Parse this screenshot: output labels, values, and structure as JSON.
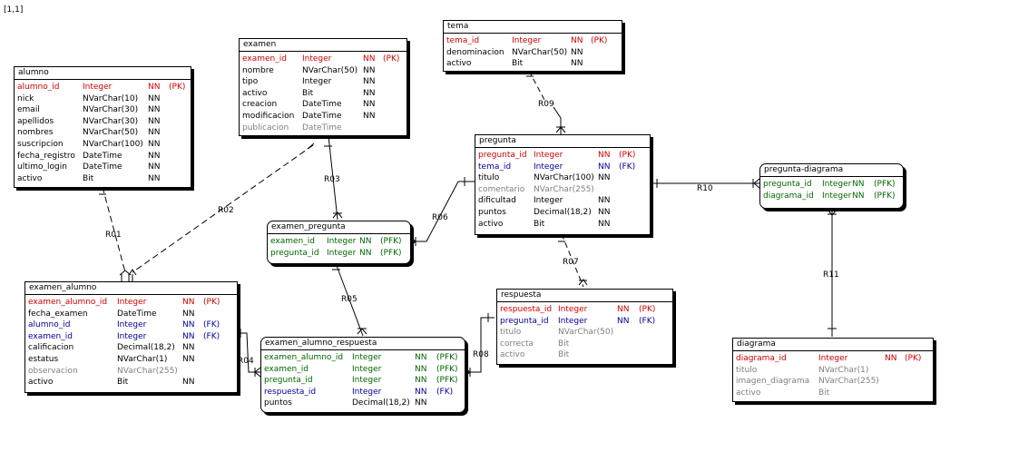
{
  "coord_label": "[1,1]",
  "entities": {
    "alumno": {
      "name": "alumno",
      "columns": [
        {
          "name": "alumno_id",
          "type": "Integer",
          "nn": "NN",
          "key": "(PK)",
          "role": "pk"
        },
        {
          "name": "nick",
          "type": "NVarChar(10)",
          "nn": "NN",
          "key": "",
          "role": ""
        },
        {
          "name": "email",
          "type": "NVarChar(30)",
          "nn": "NN",
          "key": "",
          "role": ""
        },
        {
          "name": "apellidos",
          "type": "NVarChar(30)",
          "nn": "NN",
          "key": "",
          "role": ""
        },
        {
          "name": "nombres",
          "type": "NVarChar(50)",
          "nn": "NN",
          "key": "",
          "role": ""
        },
        {
          "name": "suscripcion",
          "type": "NVarChar(100)",
          "nn": "NN",
          "key": "",
          "role": ""
        },
        {
          "name": "fecha_registro",
          "type": "DateTime",
          "nn": "NN",
          "key": "",
          "role": ""
        },
        {
          "name": "ultimo_login",
          "type": "DateTime",
          "nn": "NN",
          "key": "",
          "role": ""
        },
        {
          "name": "activo",
          "type": "Bit",
          "nn": "NN",
          "key": "",
          "role": ""
        }
      ]
    },
    "examen": {
      "name": "examen",
      "columns": [
        {
          "name": "examen_id",
          "type": "Integer",
          "nn": "NN",
          "key": "(PK)",
          "role": "pk"
        },
        {
          "name": "nombre",
          "type": "NVarChar(50)",
          "nn": "NN",
          "key": "",
          "role": ""
        },
        {
          "name": "tipo",
          "type": "Integer",
          "nn": "NN",
          "key": "",
          "role": ""
        },
        {
          "name": "activo",
          "type": "Bit",
          "nn": "NN",
          "key": "",
          "role": ""
        },
        {
          "name": "creacion",
          "type": "DateTime",
          "nn": "NN",
          "key": "",
          "role": ""
        },
        {
          "name": "modificacion",
          "type": "DateTime",
          "nn": "NN",
          "key": "",
          "role": ""
        },
        {
          "name": "publicacion",
          "type": "DateTime",
          "nn": "",
          "key": "",
          "role": "gray"
        }
      ]
    },
    "tema": {
      "name": "tema",
      "columns": [
        {
          "name": "tema_id",
          "type": "Integer",
          "nn": "NN",
          "key": "(PK)",
          "role": "pk"
        },
        {
          "name": "denominacion",
          "type": "NVarChar(50)",
          "nn": "NN",
          "key": "",
          "role": ""
        },
        {
          "name": "activo",
          "type": "Bit",
          "nn": "NN",
          "key": "",
          "role": ""
        }
      ]
    },
    "pregunta": {
      "name": "pregunta",
      "columns": [
        {
          "name": "pregunta_id",
          "type": "Integer",
          "nn": "NN",
          "key": "(PK)",
          "role": "pk"
        },
        {
          "name": "tema_id",
          "type": "Integer",
          "nn": "NN",
          "key": "(FK)",
          "role": "fk"
        },
        {
          "name": "titulo",
          "type": "NVarChar(100)",
          "nn": "NN",
          "key": "",
          "role": ""
        },
        {
          "name": "comentario",
          "type": "NVarChar(255)",
          "nn": "",
          "key": "",
          "role": "gray"
        },
        {
          "name": "dificultad",
          "type": "Integer",
          "nn": "NN",
          "key": "",
          "role": ""
        },
        {
          "name": "puntos",
          "type": "Decimal(18,2)",
          "nn": "NN",
          "key": "",
          "role": ""
        },
        {
          "name": "activo",
          "type": "Bit",
          "nn": "NN",
          "key": "",
          "role": ""
        }
      ]
    },
    "pregunta_diagrama": {
      "name": "pregunta-diagrama",
      "columns": [
        {
          "name": "pregunta_id",
          "type": "Integer",
          "nn": "NN",
          "key": "(PFK)",
          "role": "pfk"
        },
        {
          "name": "diagrama_id",
          "type": "Integer",
          "nn": "NN",
          "key": "(PFK)",
          "role": "pfk"
        }
      ]
    },
    "examen_pregunta": {
      "name": "examen_pregunta",
      "columns": [
        {
          "name": "examen_id",
          "type": "Integer",
          "nn": "NN",
          "key": "(PFK)",
          "role": "pfk"
        },
        {
          "name": "pregunta_id",
          "type": "Integer",
          "nn": "NN",
          "key": "(PFK)",
          "role": "pfk"
        }
      ]
    },
    "examen_alumno": {
      "name": "examen_alumno",
      "columns": [
        {
          "name": "examen_alumno_id",
          "type": "Integer",
          "nn": "NN",
          "key": "(PK)",
          "role": "pk"
        },
        {
          "name": "fecha_examen",
          "type": "DateTime",
          "nn": "NN",
          "key": "",
          "role": ""
        },
        {
          "name": "alumno_id",
          "type": "Integer",
          "nn": "NN",
          "key": "(FK)",
          "role": "fk"
        },
        {
          "name": "examen_id",
          "type": "Integer",
          "nn": "NN",
          "key": "(FK)",
          "role": "fk"
        },
        {
          "name": "calificacion",
          "type": "Decimal(18,2)",
          "nn": "NN",
          "key": "",
          "role": ""
        },
        {
          "name": "estatus",
          "type": "NVarChar(1)",
          "nn": "NN",
          "key": "",
          "role": ""
        },
        {
          "name": "observacion",
          "type": "NVarChar(255)",
          "nn": "",
          "key": "",
          "role": "gray"
        },
        {
          "name": "activo",
          "type": "Bit",
          "nn": "NN",
          "key": "",
          "role": ""
        }
      ]
    },
    "examen_alumno_respuesta": {
      "name": "examen_alumno_respuesta",
      "columns": [
        {
          "name": "examen_alumno_id",
          "type": "Integer",
          "nn": "NN",
          "key": "(PFK)",
          "role": "pfk"
        },
        {
          "name": "examen_id",
          "type": "Integer",
          "nn": "NN",
          "key": "(PFK)",
          "role": "pfk"
        },
        {
          "name": "pregunta_id",
          "type": "Integer",
          "nn": "NN",
          "key": "(PFK)",
          "role": "pfk"
        },
        {
          "name": "respuesta_id",
          "type": "Integer",
          "nn": "NN",
          "key": "(FK)",
          "role": "fk"
        },
        {
          "name": "puntos",
          "type": "Decimal(18,2)",
          "nn": "NN",
          "key": "",
          "role": ""
        }
      ]
    },
    "respuesta": {
      "name": "respuesta",
      "columns": [
        {
          "name": "respuesta_id",
          "type": "Integer",
          "nn": "NN",
          "key": "(PK)",
          "role": "pk"
        },
        {
          "name": "pregunta_id",
          "type": "Integer",
          "nn": "NN",
          "key": "(FK)",
          "role": "fk"
        },
        {
          "name": "titulo",
          "type": "NVarChar(50)",
          "nn": "",
          "key": "",
          "role": "gray"
        },
        {
          "name": "correcta",
          "type": "Bit",
          "nn": "",
          "key": "",
          "role": "gray"
        },
        {
          "name": "activo",
          "type": "Bit",
          "nn": "",
          "key": "",
          "role": "gray"
        }
      ]
    },
    "diagrama": {
      "name": "diagrama",
      "columns": [
        {
          "name": "diagrama_id",
          "type": "Integer",
          "nn": "NN",
          "key": "(PK)",
          "role": "pk"
        },
        {
          "name": "titulo",
          "type": "NVarChar(1)",
          "nn": "",
          "key": "",
          "role": "gray"
        },
        {
          "name": "imagen_diagrama",
          "type": "NVarChar(255)",
          "nn": "",
          "key": "",
          "role": "gray"
        },
        {
          "name": "activo",
          "type": "Bit",
          "nn": "",
          "key": "",
          "role": "gray"
        }
      ]
    }
  },
  "relationships": [
    {
      "label": "R01",
      "from": "alumno",
      "to": "examen_alumno",
      "identifying": false
    },
    {
      "label": "R02",
      "from": "examen",
      "to": "examen_alumno",
      "identifying": false
    },
    {
      "label": "R03",
      "from": "examen",
      "to": "examen_pregunta",
      "identifying": true
    },
    {
      "label": "R04",
      "from": "examen_alumno",
      "to": "examen_alumno_respuesta",
      "identifying": true
    },
    {
      "label": "R05",
      "from": "examen_pregunta",
      "to": "examen_alumno_respuesta",
      "identifying": true
    },
    {
      "label": "R06",
      "from": "pregunta",
      "to": "examen_pregunta",
      "identifying": true
    },
    {
      "label": "R07",
      "from": "pregunta",
      "to": "respuesta",
      "identifying": false
    },
    {
      "label": "R08",
      "from": "respuesta",
      "to": "examen_alumno_respuesta",
      "identifying": true
    },
    {
      "label": "R09",
      "from": "tema",
      "to": "pregunta",
      "identifying": false
    },
    {
      "label": "R10",
      "from": "pregunta",
      "to": "pregunta_diagrama",
      "identifying": true
    },
    {
      "label": "R11",
      "from": "diagrama",
      "to": "pregunta_diagrama",
      "identifying": true
    }
  ]
}
